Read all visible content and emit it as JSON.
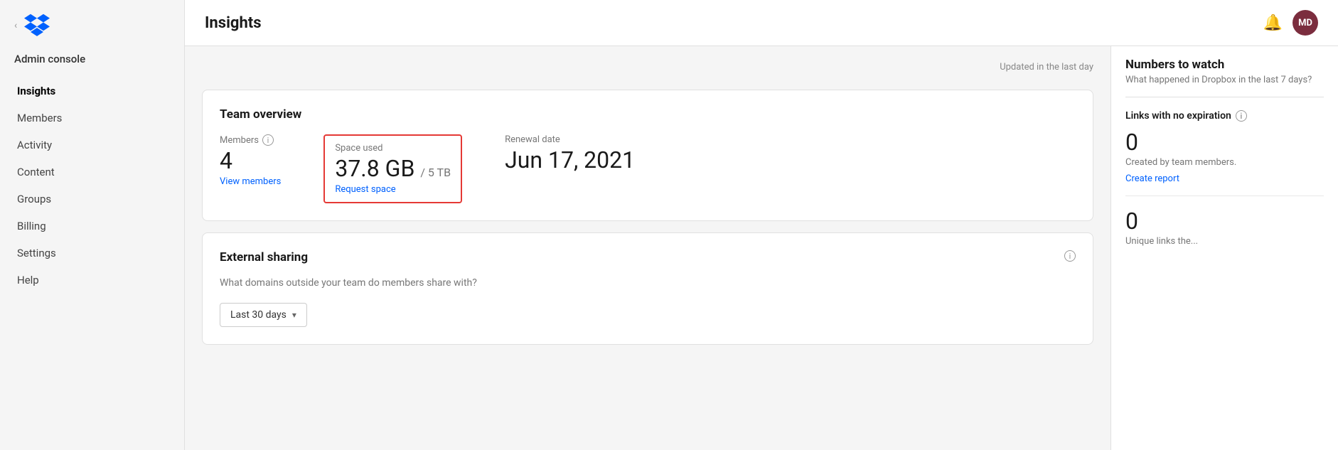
{
  "sidebar": {
    "admin_label": "Admin console",
    "chevron": "‹",
    "nav_items": [
      {
        "id": "insights",
        "label": "Insights",
        "active": true
      },
      {
        "id": "members",
        "label": "Members",
        "active": false
      },
      {
        "id": "activity",
        "label": "Activity",
        "active": false
      },
      {
        "id": "content",
        "label": "Content",
        "active": false
      },
      {
        "id": "groups",
        "label": "Groups",
        "active": false
      },
      {
        "id": "billing",
        "label": "Billing",
        "active": false
      },
      {
        "id": "settings",
        "label": "Settings",
        "active": false
      },
      {
        "id": "help",
        "label": "Help",
        "active": false
      }
    ]
  },
  "header": {
    "title": "Insights",
    "avatar_initials": "MD"
  },
  "updated_text": "Updated in the last day",
  "team_overview": {
    "card_title": "Team overview",
    "members_label": "Members",
    "members_value": "4",
    "members_link": "View members",
    "space_used_label": "Space used",
    "space_used_value": "37.8 GB",
    "space_used_unit": "/ 5 TB",
    "space_used_link": "Request space",
    "renewal_label": "Renewal date",
    "renewal_value": "Jun 17, 2021"
  },
  "external_sharing": {
    "card_title": "External sharing",
    "description": "What domains outside your team do members share with?",
    "info_icon": "i",
    "dropdown_value": "Last 30 days"
  },
  "numbers_to_watch": {
    "title": "Numbers to watch",
    "subtitle": "What happened in Dropbox in the last 7 days?",
    "links_section": {
      "label": "Links with no expiration",
      "value": "0",
      "description": "Created by team members.",
      "link_text": "Create report"
    },
    "second_stat": {
      "value": "0",
      "description": "Unique links the..."
    }
  },
  "icons": {
    "info": "ⓘ",
    "bell": "🔔",
    "chevron_down": "▾",
    "chevron_left": "‹"
  }
}
